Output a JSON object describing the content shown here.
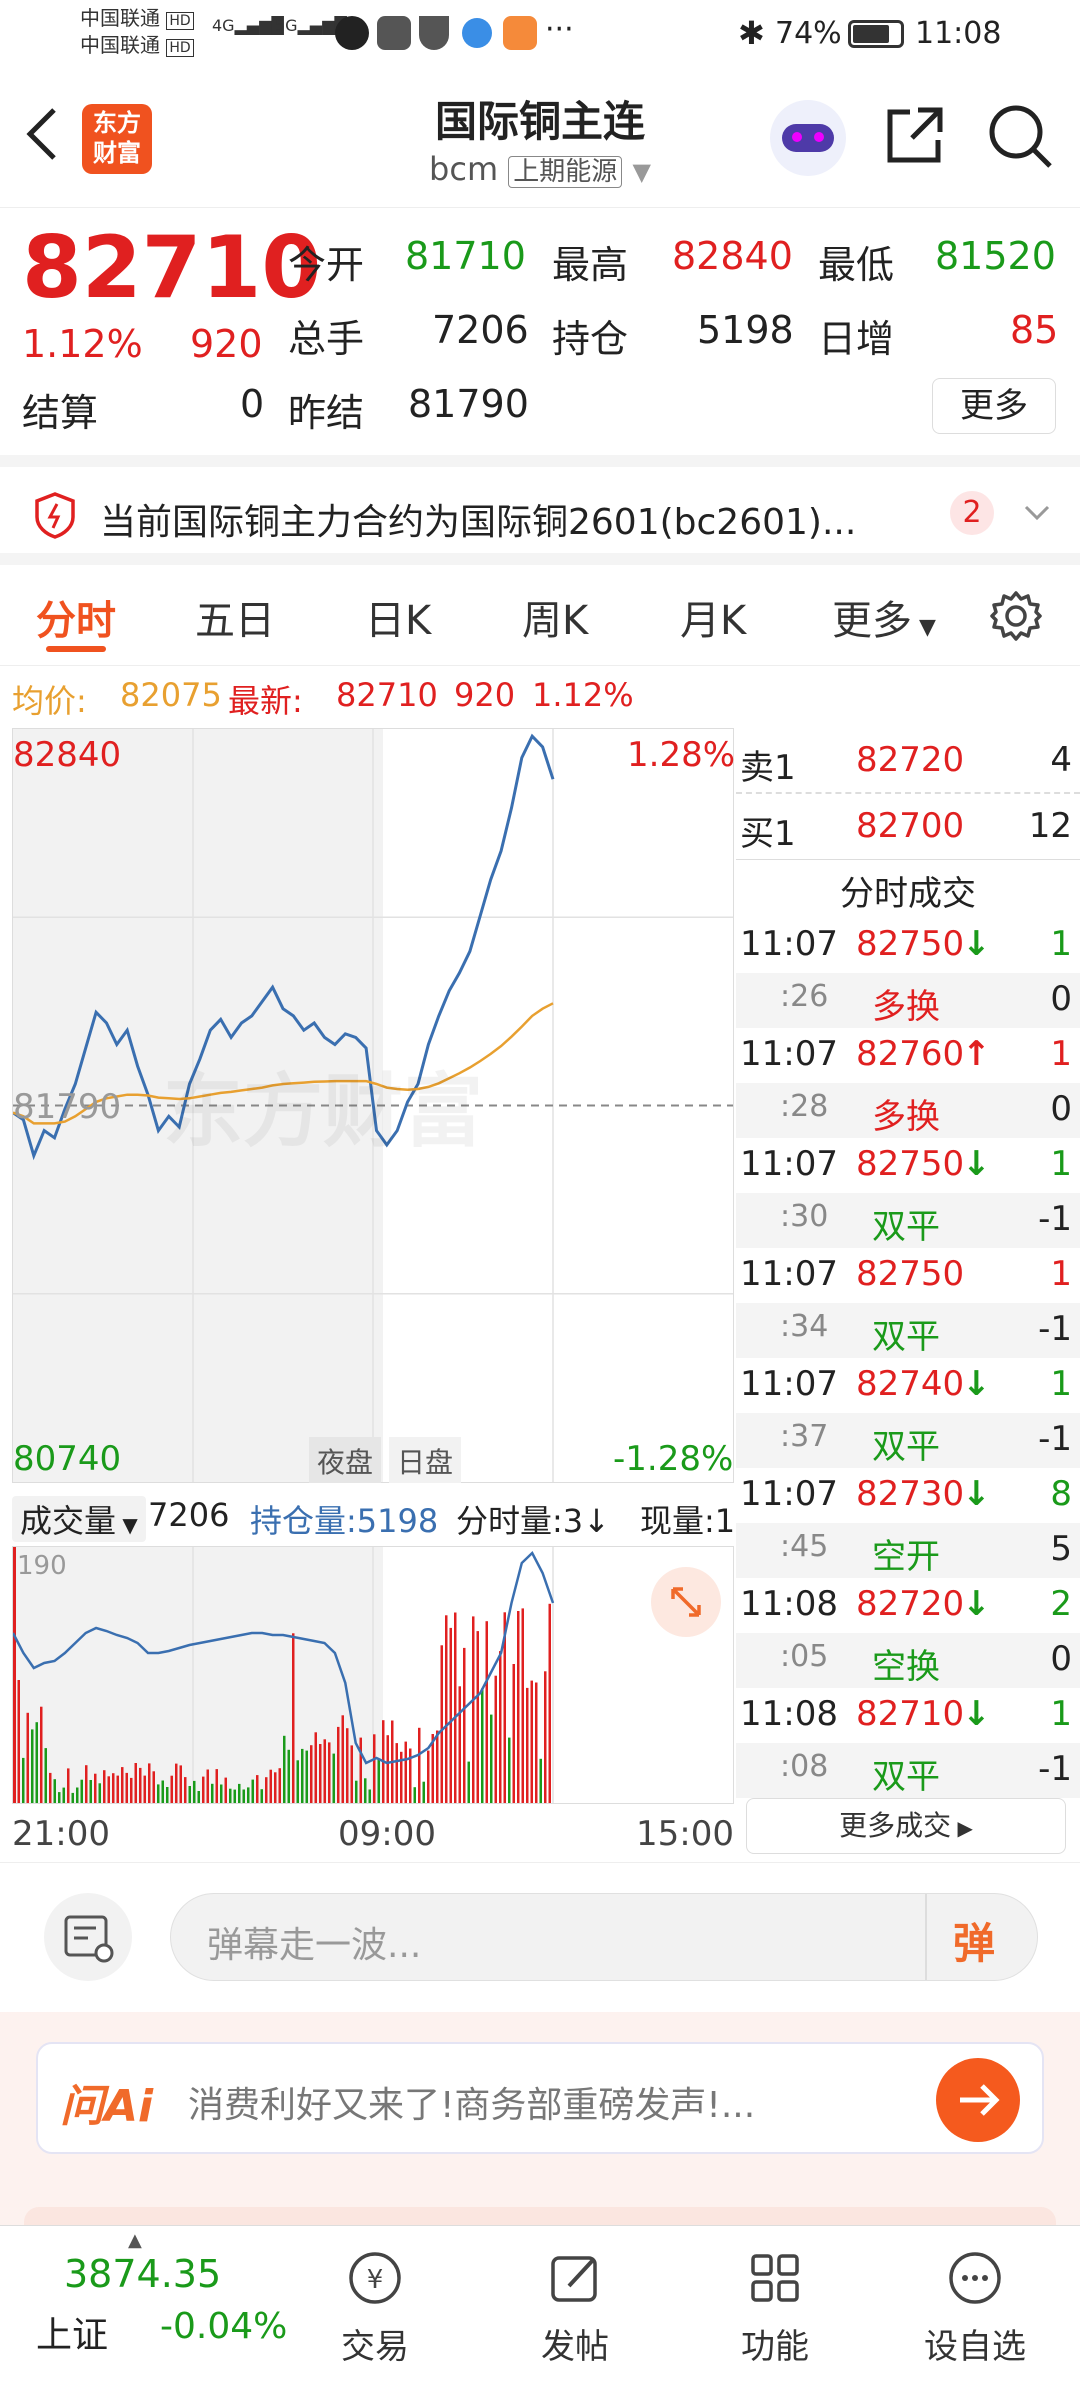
{
  "status_bar": {
    "carrier1": "中国联通",
    "carrier2": "中国联通",
    "hd": "HD",
    "net1": "4G",
    "net2": "5G",
    "dots": "···",
    "battery": "74%",
    "time": "11:08"
  },
  "header": {
    "logo_line1": "东方",
    "logo_line2": "财富",
    "title": "国际铜主连",
    "code": "bcm",
    "exchange": "上期能源"
  },
  "quote": {
    "price": "82710",
    "pct": "1.12%",
    "change": "920",
    "open_label": "今开",
    "open": "81710",
    "high_label": "最高",
    "high": "82840",
    "low_label": "最低",
    "low": "81520",
    "volume_label": "总手",
    "volume": "7206",
    "oi_label": "持仓",
    "oi": "5198",
    "daily_inc_label": "日增",
    "daily_inc": "85",
    "settle_label": "结算",
    "settle": "0",
    "prev_settle_label": "昨结",
    "prev_settle": "81790",
    "more_button": "更多"
  },
  "notice": {
    "text": "当前国际铜主力合约为国际铜2601(bc2601)...",
    "count": "2"
  },
  "tabs": [
    "分时",
    "五日",
    "日K",
    "周K",
    "月K",
    "更多"
  ],
  "avg_line": {
    "avg_label": "均价:",
    "avg_value": "82075",
    "latest_label": "最新:",
    "latest_value": "82710",
    "latest_change": "920",
    "latest_pct": "1.12%"
  },
  "chart_labels": {
    "top_price": "82840",
    "top_pct": "1.28%",
    "bottom_price": "80740",
    "bottom_pct": "-1.28%",
    "mid_price": "81790",
    "night_label": "夜盘",
    "day_label": "日盘",
    "watermark": "东方财富"
  },
  "chart_data": {
    "type": "line",
    "title": "",
    "xlabel": "",
    "ylabel": "",
    "ylim": [
      80740,
      82840
    ],
    "x_ticks": [
      "21:00",
      "09:00",
      "15:00"
    ],
    "series": [
      {
        "name": "",
        "color": "#3a6fb0",
        "values": [
          81770,
          81750,
          81650,
          81720,
          81700,
          81780,
          81850,
          81950,
          82050,
          82020,
          81960,
          82000,
          81900,
          81820,
          81720,
          81760,
          81730,
          81850,
          81920,
          82000,
          82030,
          81980,
          82020,
          82040,
          82080,
          82120,
          82060,
          82040,
          82000,
          82020,
          81980,
          81960,
          81990,
          81980,
          81950,
          81720,
          81680,
          81720,
          81800,
          81850,
          81960,
          82040,
          82110,
          82160,
          82220,
          82320,
          82420,
          82500,
          82620,
          82760,
          82820,
          82790,
          82700
        ]
      },
      {
        "name": "均价",
        "color": "#e8a030",
        "values": [
          81770,
          81760,
          81740,
          81740,
          81740,
          81745,
          81760,
          81780,
          81800,
          81810,
          81815,
          81820,
          81820,
          81818,
          81812,
          81810,
          81808,
          81810,
          81815,
          81820,
          81825,
          81828,
          81832,
          81836,
          81840,
          81846,
          81850,
          81852,
          81854,
          81856,
          81857,
          81858,
          81858,
          81858,
          81858,
          81850,
          81840,
          81836,
          81834,
          81836,
          81842,
          81852,
          81866,
          81880,
          81896,
          81914,
          81934,
          81956,
          81982,
          82010,
          82040,
          82060,
          82075
        ]
      }
    ],
    "volume_label": "成交量",
    "volume_total": "7206",
    "oi_label": "持仓量:",
    "oi_value": "5198",
    "tick_label": "分时量:3",
    "now_label": "现量:1",
    "volume_max_label": "190"
  },
  "orderbook": {
    "sell_label": "卖1",
    "sell_price": "82720",
    "sell_qty": "4",
    "buy_label": "买1",
    "buy_price": "82700",
    "buy_qty": "12",
    "trades_title": "分时成交",
    "trades": [
      {
        "time": "11:07",
        "price": "82750",
        "arrow": "↓",
        "qty": "1",
        "sub": ":26",
        "type": "多换",
        "delta": "0"
      },
      {
        "time": "11:07",
        "price": "82760",
        "arrow": "↑",
        "qty": "1",
        "sub": ":28",
        "type": "多换",
        "delta": "0"
      },
      {
        "time": "11:07",
        "price": "82750",
        "arrow": "↓",
        "qty": "1",
        "sub": ":30",
        "type": "双平",
        "delta": "-1"
      },
      {
        "time": "11:07",
        "price": "82750",
        "arrow": "",
        "qty": "1",
        "sub": ":34",
        "type": "双平",
        "delta": "-1"
      },
      {
        "time": "11:07",
        "price": "82740",
        "arrow": "↓",
        "qty": "1",
        "sub": ":37",
        "type": "双平",
        "delta": "-1"
      },
      {
        "time": "11:07",
        "price": "82730",
        "arrow": "↓",
        "qty": "8",
        "sub": ":45",
        "type": "空开",
        "delta": "5"
      },
      {
        "time": "11:08",
        "price": "82720",
        "arrow": "↓",
        "qty": "2",
        "sub": ":05",
        "type": "空换",
        "delta": "0"
      },
      {
        "time": "11:08",
        "price": "82710",
        "arrow": "↓",
        "qty": "1",
        "sub": ":08",
        "type": "双平",
        "delta": "-1"
      }
    ],
    "more_trades": "更多成交"
  },
  "tools": {
    "danmaku_placeholder": "弹幕走一波...",
    "danmaku_button": "弹"
  },
  "ai": {
    "logo": "问Ai",
    "text": "消费利好又来了!商务部重磅发声!..."
  },
  "nav": {
    "index_value": "3874.35",
    "index_name": "上证",
    "index_change": "-0.04%",
    "items": [
      "交易",
      "发帖",
      "功能",
      "设自选"
    ]
  },
  "colors": {
    "red": "#e02020",
    "green": "#1a9a1a",
    "orange": "#f06a2a",
    "blue_line": "#3a6fb0",
    "avg_line": "#e8a030"
  }
}
